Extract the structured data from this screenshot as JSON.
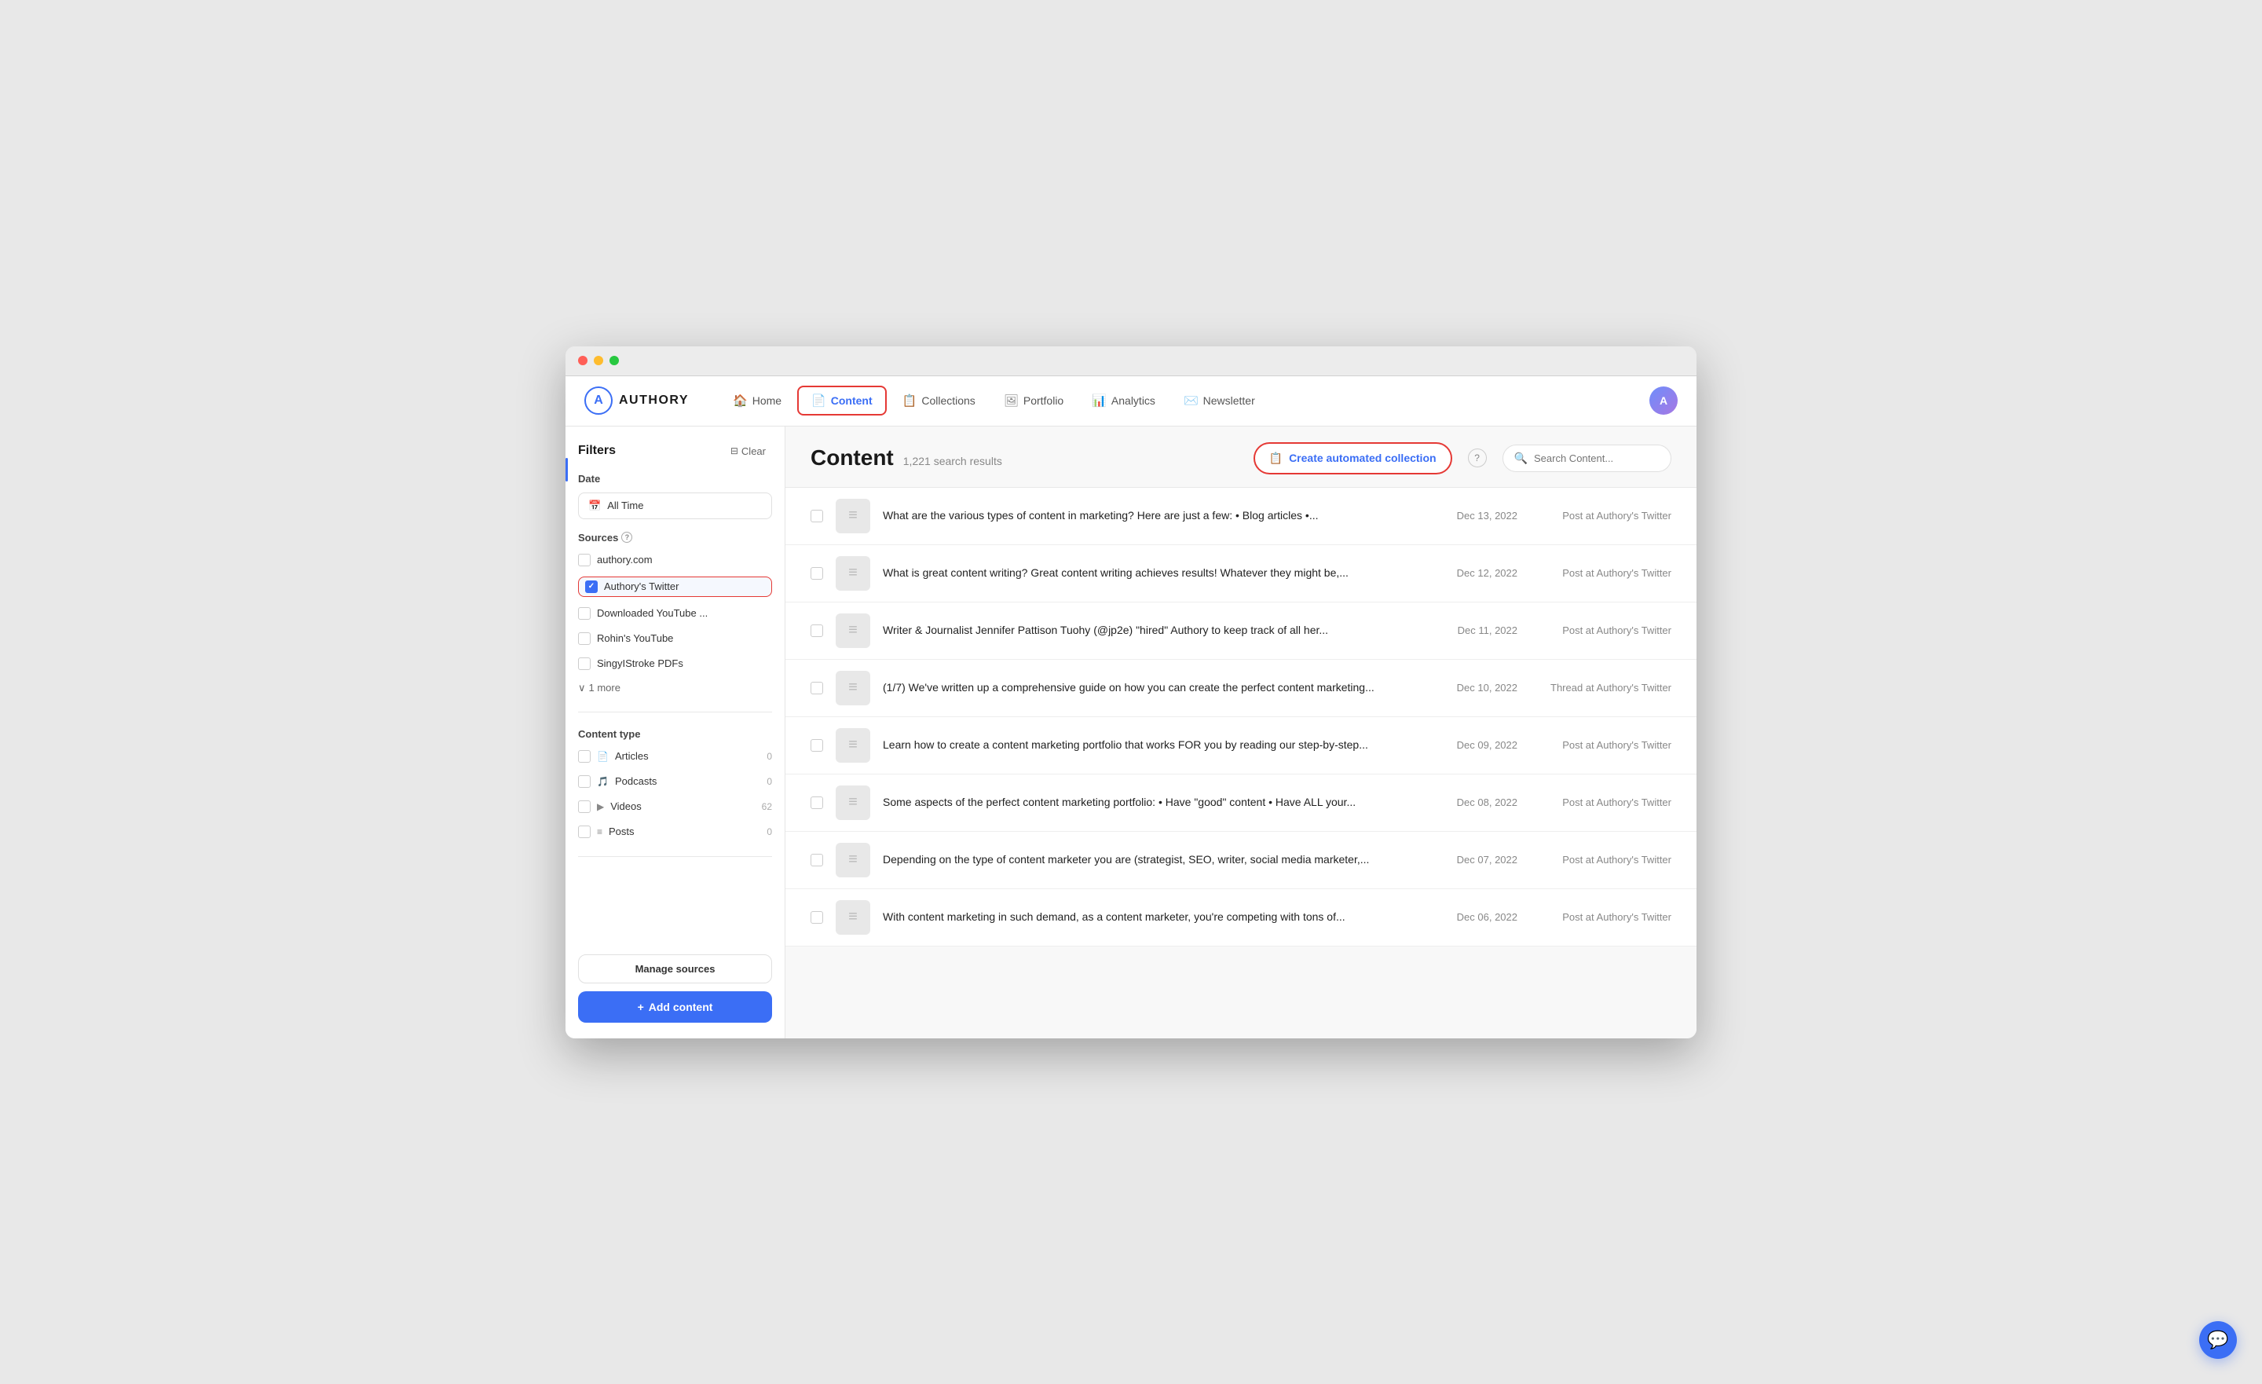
{
  "app": {
    "name": "AUTHORY",
    "logo_letter": "A"
  },
  "nav": {
    "items": [
      {
        "id": "home",
        "label": "Home",
        "icon": "🏠",
        "active": false
      },
      {
        "id": "content",
        "label": "Content",
        "icon": "📄",
        "active": true
      },
      {
        "id": "collections",
        "label": "Collections",
        "icon": "📋",
        "active": false
      },
      {
        "id": "portfolio",
        "label": "Portfolio",
        "icon": "🖼",
        "active": false
      },
      {
        "id": "analytics",
        "label": "Analytics",
        "icon": "📊",
        "active": false
      },
      {
        "id": "newsletter",
        "label": "Newsletter",
        "icon": "✉️",
        "active": false
      }
    ]
  },
  "sidebar": {
    "filters_label": "Filters",
    "clear_label": "Clear",
    "date_section_label": "Date",
    "date_value": "All Time",
    "sources_section_label": "Sources",
    "sources": [
      {
        "id": "authory",
        "label": "authory.com",
        "checked": false,
        "highlighted": false
      },
      {
        "id": "twitter",
        "label": "Authory's Twitter",
        "checked": true,
        "highlighted": true
      },
      {
        "id": "youtube-dl",
        "label": "Downloaded YouTube ...",
        "checked": false,
        "highlighted": false
      },
      {
        "id": "rohins-youtube",
        "label": "Rohin's YouTube",
        "checked": false,
        "highlighted": false
      },
      {
        "id": "singyi-pdfs",
        "label": "SingyIStroke PDFs",
        "checked": false,
        "highlighted": false
      }
    ],
    "more_label": "1 more",
    "content_type_label": "Content type",
    "content_types": [
      {
        "id": "articles",
        "label": "Articles",
        "icon": "📄",
        "count": "0"
      },
      {
        "id": "podcasts",
        "label": "Podcasts",
        "icon": "🎵",
        "count": "0"
      },
      {
        "id": "videos",
        "label": "Videos",
        "icon": "▶",
        "count": "62"
      },
      {
        "id": "posts",
        "label": "Posts",
        "icon": "≡",
        "count": "0"
      }
    ],
    "manage_sources_label": "Manage sources",
    "add_content_label": "+ Add content"
  },
  "content": {
    "title": "Content",
    "result_count": "1,221 search results",
    "create_collection_label": "Create automated collection",
    "search_placeholder": "Search Content...",
    "rows": [
      {
        "id": 1,
        "text": "What are the various types of content in marketing? Here are just a few: • Blog articles •...",
        "date": "Dec 13, 2022",
        "source": "Post at Authory's Twitter"
      },
      {
        "id": 2,
        "text": "What is great content writing? Great content writing achieves results! Whatever they might be,...",
        "date": "Dec 12, 2022",
        "source": "Post at Authory's Twitter"
      },
      {
        "id": 3,
        "text": "Writer &amp; Journalist Jennifer Pattison Tuohy (@jp2e) \"hired\" Authory to keep track of all her...",
        "date": "Dec 11, 2022",
        "source": "Post at Authory's Twitter"
      },
      {
        "id": 4,
        "text": "(1/7) We've written up a comprehensive guide on how you can create the perfect content marketing...",
        "date": "Dec 10, 2022",
        "source": "Thread at Authory's Twitter"
      },
      {
        "id": 5,
        "text": "Learn how to create a content marketing portfolio that works FOR you by reading our step-by-step...",
        "date": "Dec 09, 2022",
        "source": "Post at Authory's Twitter"
      },
      {
        "id": 6,
        "text": "Some aspects of the perfect content marketing portfolio: • Have \"good\" content • Have ALL your...",
        "date": "Dec 08, 2022",
        "source": "Post at Authory's Twitter"
      },
      {
        "id": 7,
        "text": "Depending on the type of content marketer you are (strategist, SEO, writer, social media marketer,...",
        "date": "Dec 07, 2022",
        "source": "Post at Authory's Twitter"
      },
      {
        "id": 8,
        "text": "With content marketing in such demand, as a content marketer, you're competing with tons of...",
        "date": "Dec 06, 2022",
        "source": "Post at Authory's Twitter"
      }
    ]
  }
}
